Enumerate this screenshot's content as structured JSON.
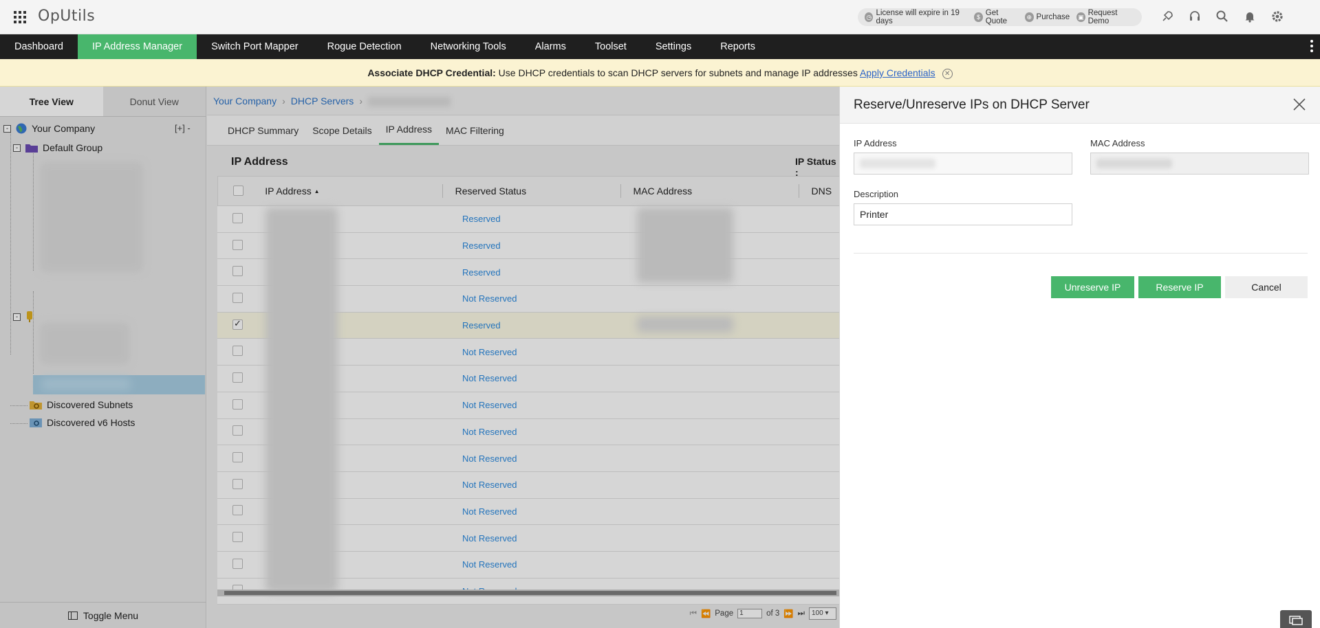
{
  "app": {
    "brand": "OpUtils"
  },
  "license": {
    "expire": "License will expire in 19 days",
    "get_quote": "Get Quote",
    "purchase": "Purchase",
    "request_demo": "Request Demo"
  },
  "nav": {
    "items": [
      {
        "label": "Dashboard"
      },
      {
        "label": "IP Address Manager"
      },
      {
        "label": "Switch Port Mapper"
      },
      {
        "label": "Rogue Detection"
      },
      {
        "label": "Networking Tools"
      },
      {
        "label": "Alarms"
      },
      {
        "label": "Toolset"
      },
      {
        "label": "Settings"
      },
      {
        "label": "Reports"
      }
    ]
  },
  "banner": {
    "bold": "Associate DHCP Credential:",
    "text": " Use DHCP credentials to scan DHCP servers for subnets and manage IP addresses ",
    "link": "Apply Credentials"
  },
  "left": {
    "tabs": [
      "Tree View",
      "Donut View"
    ],
    "tree": {
      "root": "Your Company",
      "root_actions": "[+]  -",
      "default_group": "Default Group",
      "discovered_subnets": "Discovered Subnets",
      "discovered_v6": "Discovered v6 Hosts"
    },
    "toggle": "Toggle Menu"
  },
  "breadcrumb": {
    "items": [
      "Your Company",
      "DHCP Servers"
    ]
  },
  "subtabs": [
    "DHCP Summary",
    "Scope Details",
    "IP Address",
    "MAC Filtering"
  ],
  "section": {
    "title": "IP Address",
    "ip_status": "IP Status :"
  },
  "table": {
    "headers": [
      "IP Address",
      "Reserved Status",
      "MAC Address",
      "DNS"
    ],
    "sort_indicator": "▲",
    "rows": [
      {
        "status": "Reserved",
        "checked": false
      },
      {
        "status": "Reserved",
        "checked": false
      },
      {
        "status": "Reserved",
        "checked": false
      },
      {
        "status": "Not Reserved",
        "checked": false
      },
      {
        "status": "Reserved",
        "checked": true
      },
      {
        "status": "Not Reserved",
        "checked": false
      },
      {
        "status": "Not Reserved",
        "checked": false
      },
      {
        "status": "Not Reserved",
        "checked": false
      },
      {
        "status": "Not Reserved",
        "checked": false
      },
      {
        "status": "Not Reserved",
        "checked": false
      },
      {
        "status": "Not Reserved",
        "checked": false
      },
      {
        "status": "Not Reserved",
        "checked": false
      },
      {
        "status": "Not Reserved",
        "checked": false
      },
      {
        "status": "Not Reserved",
        "checked": false
      },
      {
        "status": "Not Reserved",
        "checked": false
      }
    ]
  },
  "pager": {
    "page_label": "Page",
    "page": "1",
    "of": "of 3",
    "per_page": "100"
  },
  "drawer": {
    "title": "Reserve/Unreserve IPs on DHCP Server",
    "ip_label": "IP Address",
    "mac_label": "MAC Address",
    "desc_label": "Description",
    "desc_value": "Printer",
    "unreserve": "Unreserve IP",
    "reserve": "Reserve IP",
    "cancel": "Cancel"
  },
  "colors": {
    "accent": "#48b66c",
    "nav_bg": "#1f1f1f",
    "link": "#2b8be0",
    "banner_bg": "#fbf3d2"
  }
}
